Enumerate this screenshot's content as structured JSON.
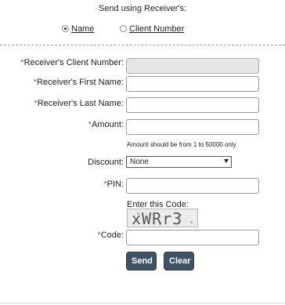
{
  "header": {
    "title": "Send using Receiver's:"
  },
  "send_mode": {
    "options": [
      {
        "label": "Name",
        "selected": true
      },
      {
        "label": "Client Number",
        "selected": false
      }
    ]
  },
  "form": {
    "required_marker": "*",
    "client_number": {
      "label": "Receiver's Client Number:",
      "value": ""
    },
    "first_name": {
      "label": "Receiver's First Name:",
      "value": ""
    },
    "last_name": {
      "label": "Receiver's Last Name:",
      "value": ""
    },
    "amount": {
      "label": "Amount:",
      "value": "",
      "hint": "Amount should be from 1 to 50000 only"
    },
    "discount": {
      "label": "Discount:",
      "selected": "None"
    },
    "pin": {
      "label": "PIN:",
      "value": ""
    },
    "captcha": {
      "prompt": "Enter this Code:",
      "image_text": "xWRr3"
    },
    "code": {
      "label": "Code:",
      "value": ""
    }
  },
  "actions": {
    "send_label": "Send",
    "clear_label": "Clear"
  }
}
